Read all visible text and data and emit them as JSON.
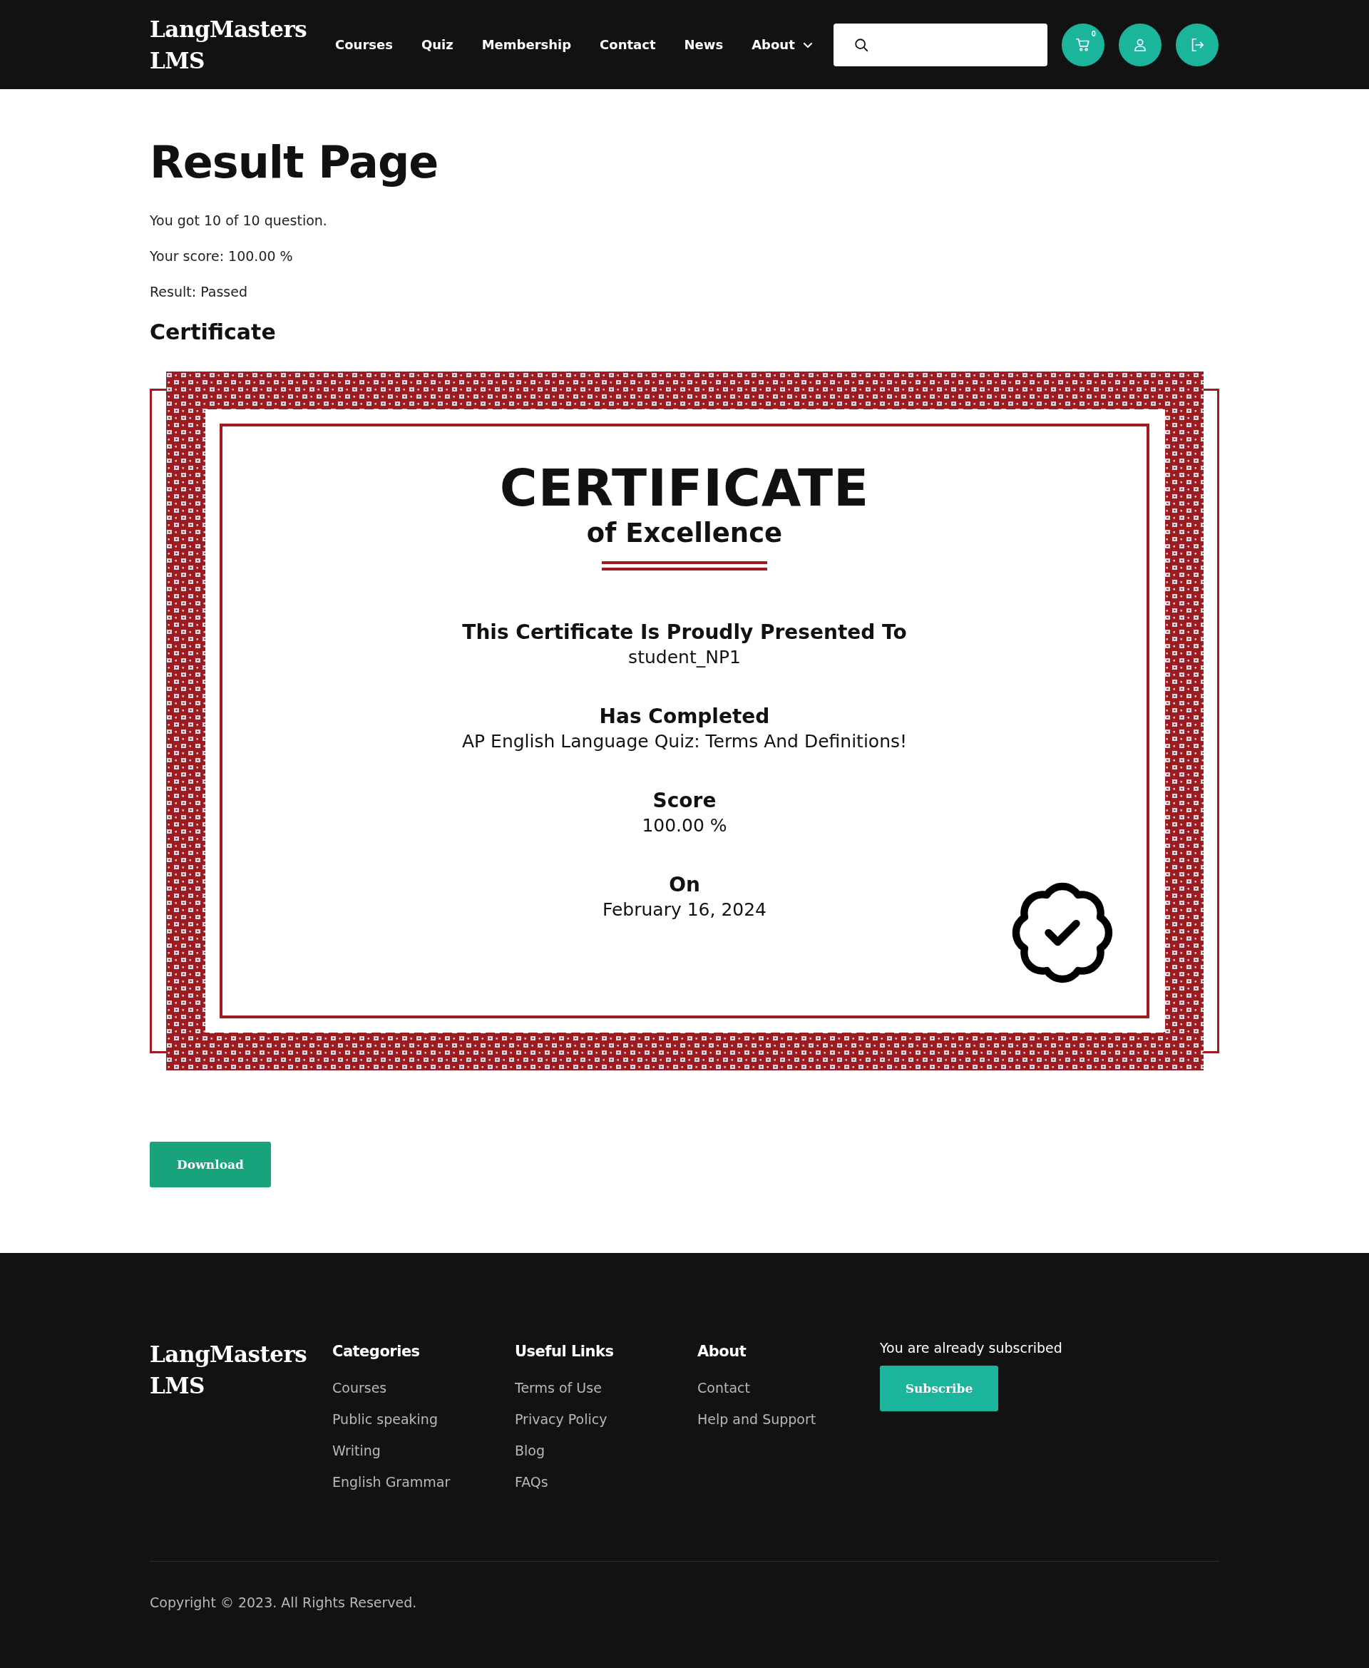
{
  "header": {
    "logo": [
      "LangMasters",
      "LMS"
    ],
    "nav": [
      {
        "label": "Courses",
        "has_menu": false
      },
      {
        "label": "Quiz",
        "has_menu": false
      },
      {
        "label": "Membership",
        "has_menu": false
      },
      {
        "label": "Contact",
        "has_menu": false
      },
      {
        "label": "News",
        "has_menu": false
      },
      {
        "label": "About",
        "has_menu": true
      }
    ],
    "cart_count": "0"
  },
  "page": {
    "title": "Result Page",
    "lines": [
      "You got 10 of 10 question.",
      "Your score: 100.00 %",
      "Result: Passed"
    ],
    "section_title": "Certificate"
  },
  "certificate": {
    "title": "CERTIFICATE",
    "subtitle": "of Excellence",
    "fields": [
      {
        "label": "This Certificate Is Proudly Presented To",
        "value": "student_NP1"
      },
      {
        "label": "Has Completed",
        "value": "AP English Language Quiz: Terms And Definitions!"
      },
      {
        "label": "Score",
        "value": "100.00 %"
      },
      {
        "label": "On",
        "value": "February 16, 2024"
      }
    ]
  },
  "download_button": "Download",
  "footer": {
    "logo": [
      "LangMasters",
      "LMS"
    ],
    "columns": [
      {
        "title": "Categories",
        "links": [
          "Courses",
          "Public speaking",
          "Writing",
          "English Grammar"
        ]
      },
      {
        "title": "Useful Links",
        "links": [
          "Terms of Use",
          "Privacy Policy",
          "Blog",
          "FAQs"
        ]
      },
      {
        "title": "About",
        "links": [
          "Contact",
          "Help and Support"
        ]
      }
    ],
    "subscribe_note": "You are already subscribed",
    "subscribe_button": "Subscribe",
    "copyright": "Copyright © 2023. All Rights Reserved."
  }
}
